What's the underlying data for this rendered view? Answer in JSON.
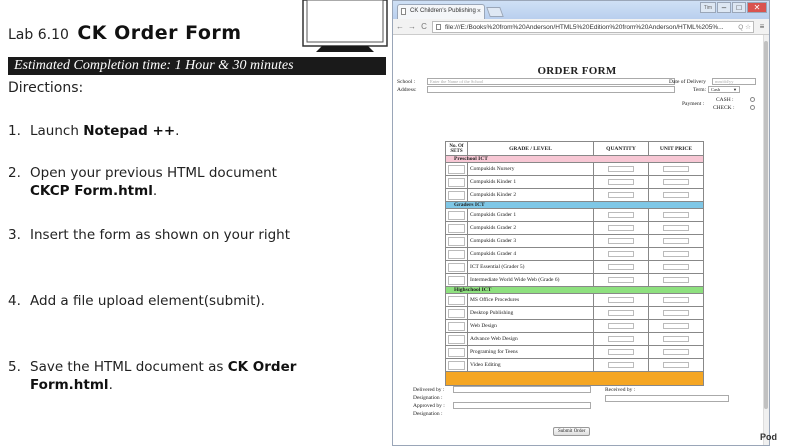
{
  "lesson": {
    "prefix": "Lab 6.10",
    "title": "CK Order Form",
    "time": "Estimated Completion time: 1 Hour & 30 minutes",
    "directions_label": "Directions:",
    "steps": [
      {
        "num": "1.",
        "pre": "Launch ",
        "bold": "Notepad ++",
        "post": "."
      },
      {
        "num": "2.",
        "pre": "Open your previous HTML document ",
        "bold": "CKCP Form.html",
        "post": "."
      },
      {
        "num": "3.",
        "pre": "Insert the form as shown on your right",
        "bold": "",
        "post": ""
      },
      {
        "num": "4.",
        "pre": "Add a file upload element(submit).",
        "bold": "",
        "post": ""
      },
      {
        "num": "5.",
        "pre": "Save the HTML document as ",
        "bold": "CK Order Form.html",
        "post": "."
      }
    ]
  },
  "browser": {
    "tab_title": "CK Children's Publishing",
    "tab_close": "×",
    "url": "file:///E:/Books%20from%20Anderson/HTML5%20Edition%20from%20Anderson/HTML%205%...",
    "url_tools": "Q ☆",
    "nav": {
      "back": "←",
      "forward": "→",
      "reload": "C",
      "menu": "≡"
    },
    "window_buttons": {
      "user": "Tim",
      "minimize": "–",
      "maximize": "□",
      "close": "✕"
    }
  },
  "form": {
    "title": "ORDER FORM",
    "school_label": "School :",
    "school_placeholder": "Enter the Name of the School",
    "address_label": "Address:",
    "delivery_label": "Date of Delivery",
    "delivery_placeholder": "mm/dd/yy",
    "term_label": "Term:",
    "term_value": "Cash",
    "payment_label": "Payment :",
    "cash_label": "CASH :",
    "check_label": "CHECK :",
    "columns": [
      "No. Of SETS",
      "GRADE / LEVEL",
      "QUANTITY",
      "UNIT PRICE"
    ],
    "categories": [
      {
        "name": "Preschool ICT",
        "color": "#f7c7d4",
        "items": [
          "Compukids Nursery",
          "Compukids Kinder 1",
          "Compukids Kinder 2"
        ]
      },
      {
        "name": "Graders ICT",
        "color": "#7fc7e6",
        "items": [
          "Compukids Grader 1",
          "Compukids Grader 2",
          "Compukids Grader 3",
          "Compukids Grader 4",
          "ICT Essential (Grader 5)",
          "Intermediate World Wide Web (Grade 6)"
        ]
      },
      {
        "name": "Highschool ICT",
        "color": "#8ee07f",
        "items": [
          "MS Office Procedures",
          "Desktop Publishing",
          "Web Design",
          "Advance Web Design",
          "Programing for Teens",
          "Video Editing"
        ]
      }
    ],
    "footer_color": "#f5a623",
    "delivered_by_label": "Delivered by :",
    "designation_label_1": "Designation :",
    "approved_by_label": "Approved by :",
    "designation_label_2": "Designation :",
    "received_by_label": "Received by :",
    "submit_label": "Submit Order"
  },
  "page_corner_text": "Pod"
}
